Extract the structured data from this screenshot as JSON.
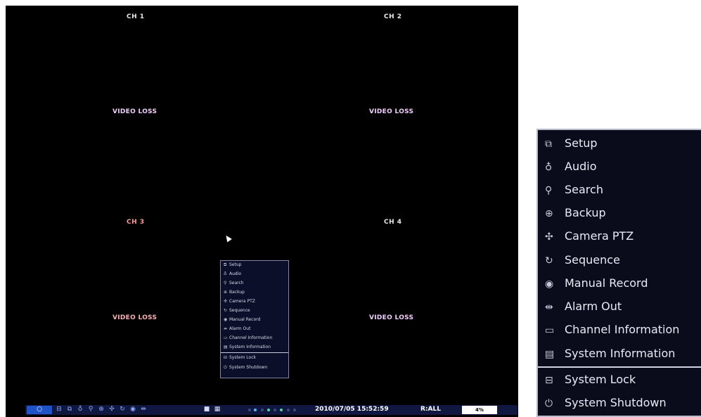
{
  "channels": [
    {
      "label": "CH 1",
      "status": "VIDEO LOSS"
    },
    {
      "label": "CH 2",
      "status": "VIDEO LOSS"
    },
    {
      "label": "CH 3",
      "status": "VIDEO LOSS"
    },
    {
      "label": "CH 4",
      "status": "VIDEO LOSS"
    }
  ],
  "menu": {
    "items": [
      {
        "label": "Setup",
        "icon": "setup-icon",
        "glyph": "⧉"
      },
      {
        "label": "Audio",
        "icon": "audio-icon",
        "glyph": "♁"
      },
      {
        "label": "Search",
        "icon": "search-icon",
        "glyph": "⚲"
      },
      {
        "label": "Backup",
        "icon": "backup-icon",
        "glyph": "⊕"
      },
      {
        "label": "Camera PTZ",
        "icon": "ptz-icon",
        "glyph": "✣"
      },
      {
        "label": "Sequence",
        "icon": "sequence-icon",
        "glyph": "↻"
      },
      {
        "label": "Manual Record",
        "icon": "record-icon",
        "glyph": "◉"
      },
      {
        "label": "Alarm Out",
        "icon": "alarm-icon",
        "glyph": "⇹"
      },
      {
        "label": "Channel Information",
        "icon": "channel-info-icon",
        "glyph": "▭"
      },
      {
        "label": "System Information",
        "icon": "system-info-icon",
        "glyph": "▤"
      },
      {
        "label": "System Lock",
        "icon": "lock-icon",
        "glyph": "⊟"
      },
      {
        "label": "System Shutdown",
        "icon": "power-icon",
        "glyph": "⏻"
      }
    ]
  },
  "taskbar": {
    "datetime": "2010/07/05 15:52:59",
    "record_mode": "R:ALL",
    "hdd_usage": "4%",
    "icons": [
      "home-icon",
      "display-icon",
      "setup-icon",
      "audio-icon",
      "search-icon",
      "backup-icon",
      "ptz-icon",
      "sequence-icon",
      "record-icon",
      "alarm-icon",
      "single-view-icon",
      "quad-view-icon"
    ]
  },
  "colors": {
    "screen": "#000000",
    "menu_bg": "#0a0c1c",
    "taskbar": "#101842",
    "accent": "#1e54c8"
  }
}
